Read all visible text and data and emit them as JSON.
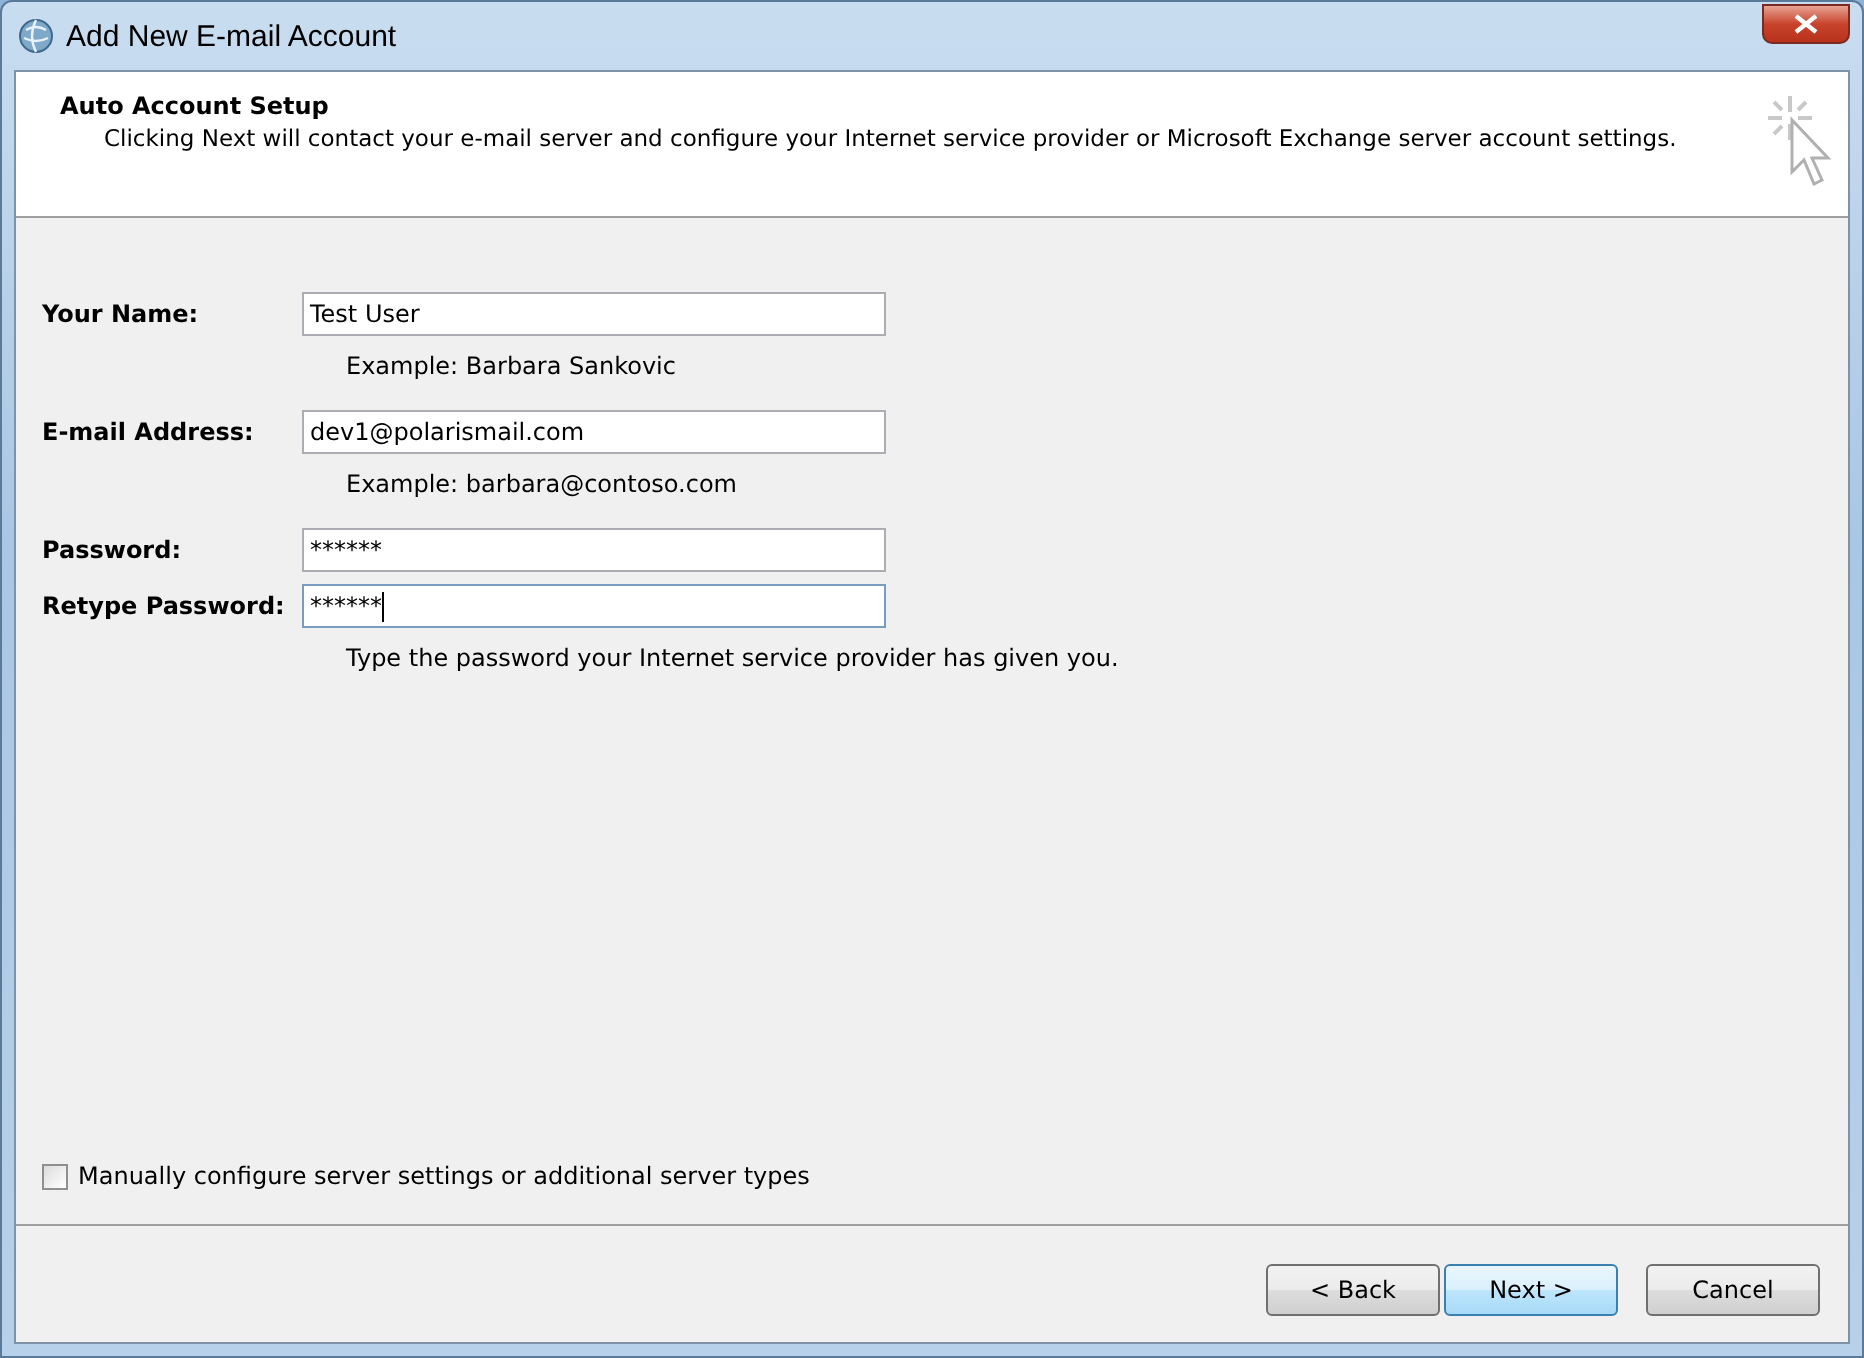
{
  "window": {
    "title": "Add New E-mail Account"
  },
  "header": {
    "title": "Auto Account Setup",
    "description": "Clicking Next will contact your e-mail server and configure your Internet service provider or Microsoft Exchange server account settings."
  },
  "fields": [
    {
      "label": "Your Name:",
      "value": "Test User",
      "example": "Example: Barbara Sankovic",
      "focused": false
    },
    {
      "label": "E-mail Address:",
      "value": "dev1@polarismail.com",
      "example": "Example: barbara@contoso.com",
      "focused": false
    },
    {
      "label": "Password:",
      "value": "******",
      "focused": false
    },
    {
      "label": "Retype Password:",
      "value": "******",
      "example": "Type the password your Internet service provider has given you.",
      "focused": true
    }
  ],
  "manual_config": {
    "label": "Manually configure server settings or additional server types",
    "checked": false
  },
  "buttons": [
    {
      "label": "< Back",
      "default": false
    },
    {
      "label": "Next >",
      "default": true
    },
    {
      "label": "Cancel",
      "default": false
    }
  ]
}
